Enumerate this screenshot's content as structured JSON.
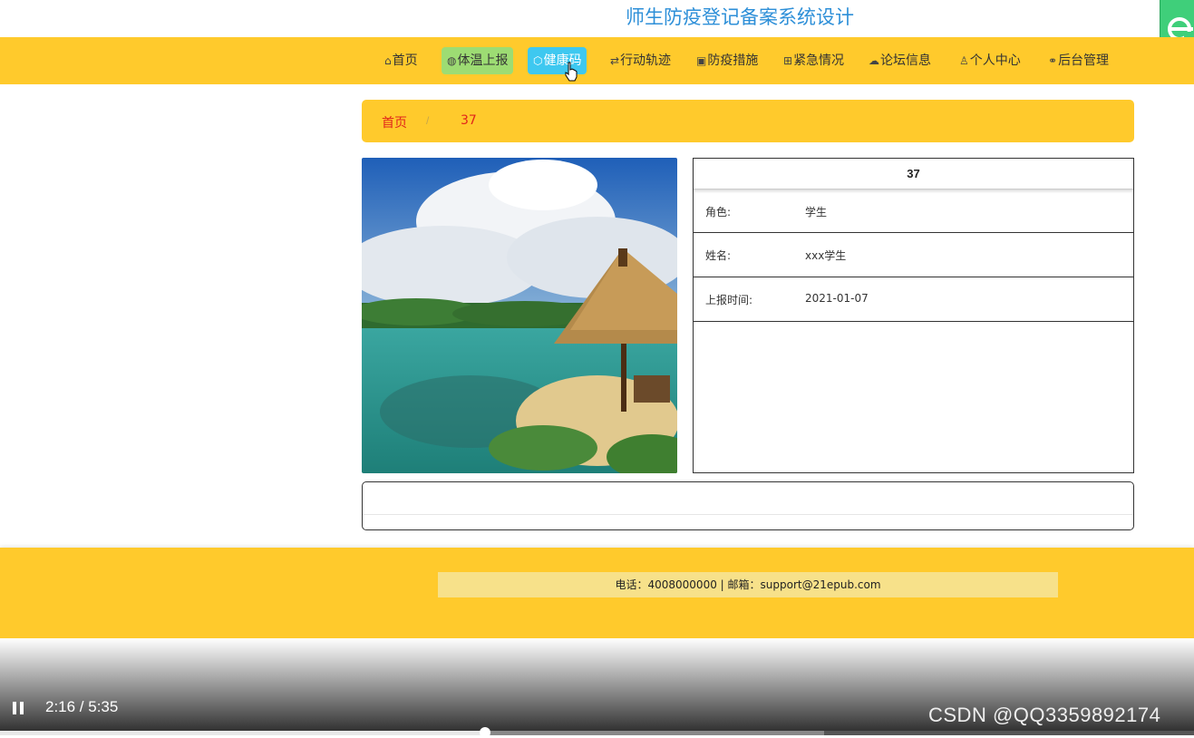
{
  "site": {
    "title": "师生防疫登记备案系统设计"
  },
  "nav": {
    "items": [
      {
        "label": "首页",
        "icon": "home-icon"
      },
      {
        "label": "体温上报",
        "icon": "globe-icon"
      },
      {
        "label": "健康码",
        "icon": "cube-icon"
      },
      {
        "label": "行动轨迹",
        "icon": "shuffle-icon"
      },
      {
        "label": "防疫措施",
        "icon": "clipboard-icon"
      },
      {
        "label": "紧急情况",
        "icon": "grid-icon"
      },
      {
        "label": "论坛信息",
        "icon": "cloud-icon"
      },
      {
        "label": "个人中心",
        "icon": "user-icon"
      },
      {
        "label": "后台管理",
        "icon": "link-icon"
      }
    ],
    "colors": {
      "bar": "#ffca2c",
      "green": "#9ddc73",
      "cyan": "#3ec8f0"
    }
  },
  "breadcrumb": {
    "home": "首页",
    "separator": "/",
    "current": "37"
  },
  "detail": {
    "title": "37",
    "rows": [
      {
        "key": "角色:",
        "value": "学生"
      },
      {
        "key": "姓名:",
        "value": "xxx学生"
      },
      {
        "key": "上报时间:",
        "value": "2021-01-07"
      }
    ]
  },
  "footer": {
    "info": "电话：4008000000 | 邮箱：support@21epub.com"
  },
  "player": {
    "time": "2:16 / 5:35",
    "watermark": "CSDN @QQ3359892174",
    "progress": 0.406,
    "buffered": 0.69
  }
}
